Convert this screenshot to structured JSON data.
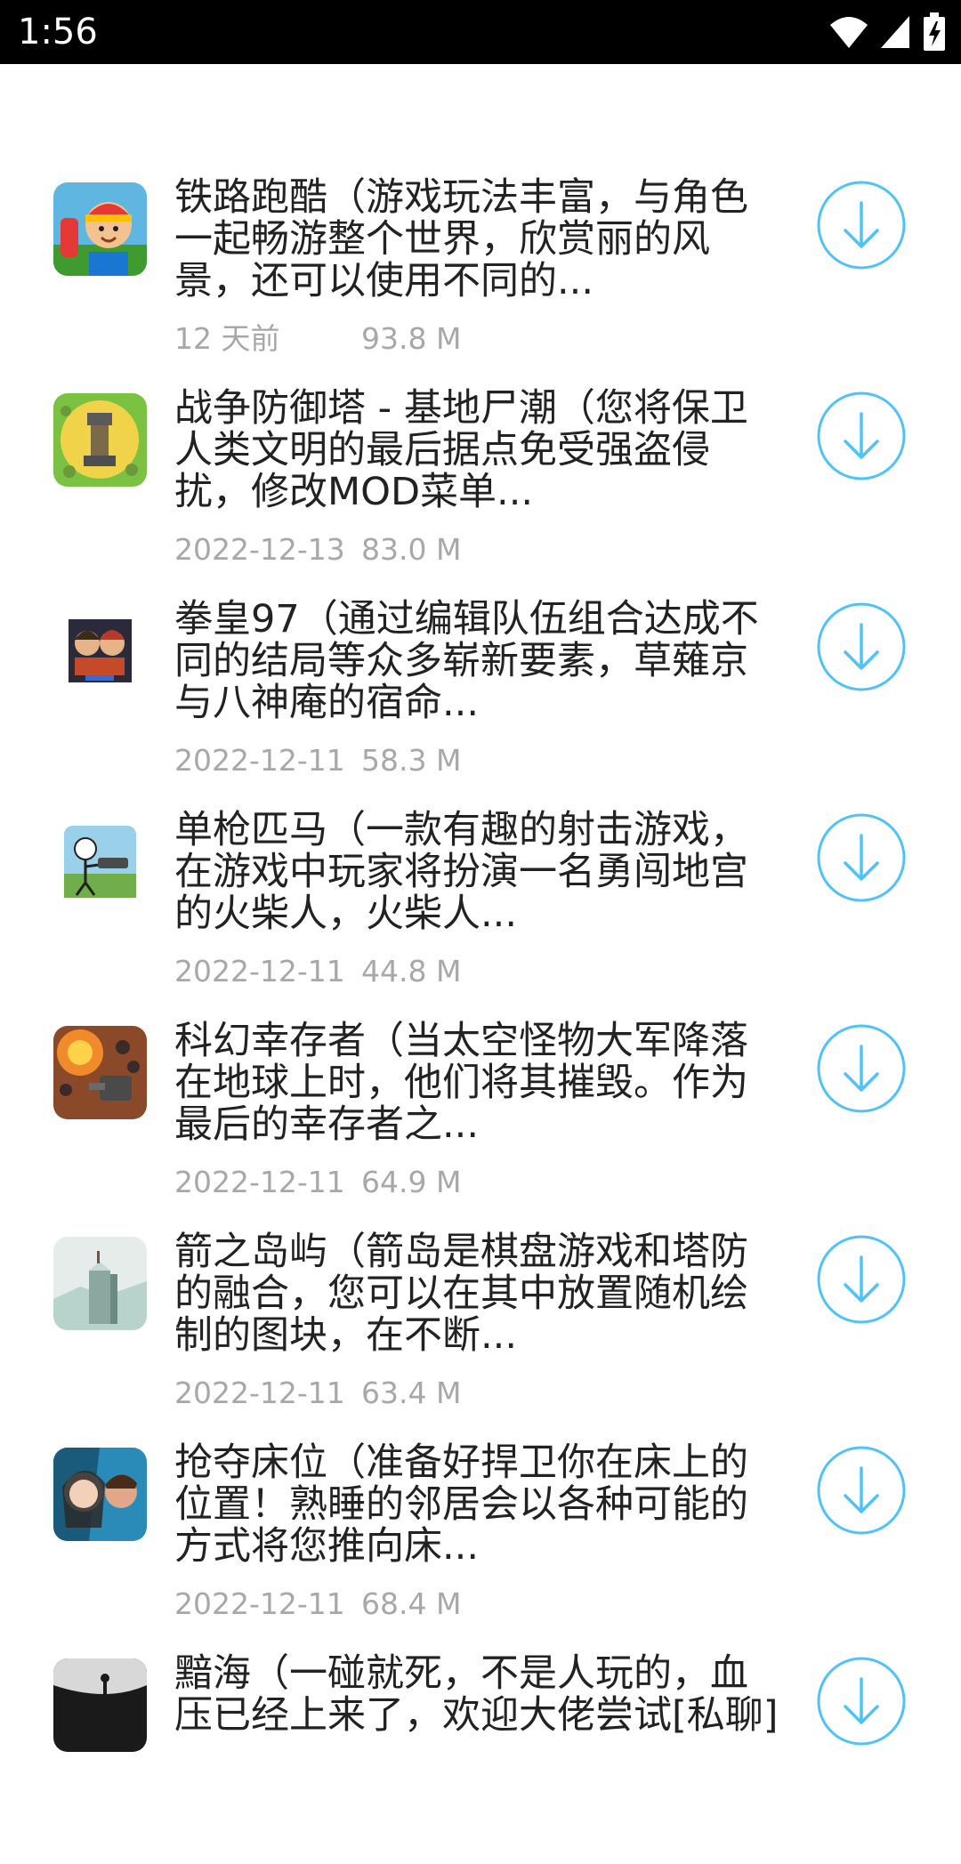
{
  "status_bar": {
    "time": "1:56",
    "icons": [
      "wifi-icon",
      "signal-icon",
      "battery-charging-icon"
    ]
  },
  "colors": {
    "accent": "#4fc3f7",
    "title_text": "#222222",
    "meta_text": "#a8a8a8"
  },
  "apps": [
    {
      "title": "铁路跑酷（游戏玩法丰富，与角色\n一起畅游整个世界，欣赏丽的风\n景，还可以使用不同的...",
      "date": "12 天前",
      "size": "93.8 M",
      "icon": "subway-runner-icon"
    },
    {
      "title": "战争防御塔 - 基地尸潮（您将保卫\n人类文明的最后据点免受强盗侵\n扰，修改MOD菜单...",
      "date": "2022-12-13",
      "size": "83.0 M",
      "icon": "tower-defense-icon"
    },
    {
      "title": "拳皇97（通过编辑队伍组合达成不\n同的结局等众多崭新要素，草薙京\n与八神庵的宿命...",
      "date": "2022-12-11",
      "size": "58.3 M",
      "icon": "kof97-icon"
    },
    {
      "title": "单枪匹马（一款有趣的射击游戏，\n在游戏中玩家将扮演一名勇闯地宫\n的火柴人，火柴人...",
      "date": "2022-12-11",
      "size": "44.8 M",
      "icon": "stickman-shooter-icon"
    },
    {
      "title": "科幻幸存者（当太空怪物大军降落\n在地球上时，他们将其摧毁。作为\n最后的幸存者之...",
      "date": "2022-12-11",
      "size": "64.9 M",
      "icon": "scifi-survivor-icon"
    },
    {
      "title": "箭之岛屿（箭岛是棋盘游戏和塔防\n的融合，您可以在其中放置随机绘\n制的图块，在不断...",
      "date": "2022-12-11",
      "size": "63.4 M",
      "icon": "arrow-island-icon"
    },
    {
      "title": "抢夺床位（准备好捍卫你在床上的\n位置！熟睡的邻居会以各种可能的\n方式将您推向床...",
      "date": "2022-12-11",
      "size": "68.4 M",
      "icon": "bed-fight-icon"
    },
    {
      "title": "黯海（一碰就死，不是人玩的，血\n压已经上来了，欢迎大佬尝试[私聊]",
      "date": "",
      "size": "",
      "icon": "dark-sea-icon"
    }
  ]
}
